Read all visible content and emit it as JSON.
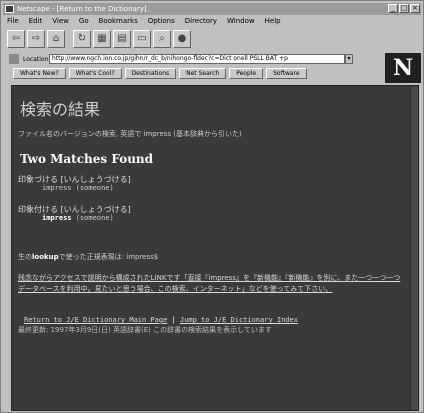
{
  "window": {
    "title": "Netscape - [Return to the Dictionary]",
    "buttons": [
      "_",
      "□",
      "×"
    ]
  },
  "menu": [
    "File",
    "Edit",
    "View",
    "Go",
    "Bookmarks",
    "Options",
    "Directory",
    "Window",
    "Help"
  ],
  "toolbar": {
    "buttons": [
      {
        "icon": "back-icon",
        "glyph": "⇦"
      },
      {
        "icon": "forward-icon",
        "glyph": "⇨"
      },
      {
        "icon": "home-icon",
        "glyph": "⌂"
      },
      {
        "icon": "reload-icon",
        "glyph": "↻"
      },
      {
        "icon": "images-icon",
        "glyph": "▦"
      },
      {
        "icon": "open-icon",
        "glyph": "▤"
      },
      {
        "icon": "print-icon",
        "glyph": "▭"
      },
      {
        "icon": "find-icon",
        "glyph": "⌕"
      },
      {
        "icon": "stop-icon",
        "glyph": "●"
      }
    ]
  },
  "location": {
    "label": "Location:",
    "value": "http://www.ngch.ion.co.jp/gihn/r_dc_b/nihongo-fldec?c=Dict onell PSLL BAT +p"
  },
  "directory": [
    "What's New?",
    "What's Cool?",
    "Destinations",
    "Net Search",
    "People",
    "Software"
  ],
  "page": {
    "heading": "検索の結果",
    "subtitle": "ファイル名のバージョンの検索, 英語で impress (基本辞典から引いた)",
    "matches": "Two Matches Found",
    "entries": [
      {
        "heading": "印象づける [いんしょうづける]",
        "word": "impress",
        "gloss": "(someone)",
        "bold": false
      },
      {
        "heading": "印象付ける [いんしょうづける]",
        "word": "impress",
        "gloss": "(someone)",
        "bold": true
      }
    ],
    "lookup": {
      "prefix": "生の",
      "bold": "lookup",
      "suffix": "で使った正規表現は: impress$"
    },
    "paragraph": "残念ながらアクセスで説明から構成されたLINKです「直接『impress』を『新機能』『新機能』を別に、また一つ一つ一つデータベースを利用中。見たいと思う場合、この検索、インターネット」などを使ってみて下さい。",
    "returns": {
      "back": "Return to J/E Dictionary Main Page",
      "sep": " | ",
      "jump": "Jump to J/E Dictionary Index"
    },
    "footer": "最終更新: 1997年3月9日(日) 英語辞書(E) この辞書の検索結果を表示しています"
  }
}
